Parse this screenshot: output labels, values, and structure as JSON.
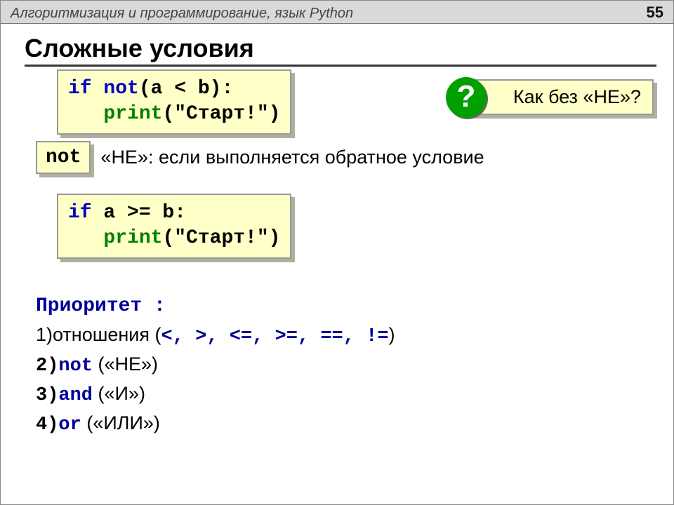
{
  "header": {
    "title": "Алгоритмизация и программирование, язык Python",
    "page": "55"
  },
  "heading": "Сложные условия",
  "code1": {
    "tok_if": "if",
    "tok_not": "not",
    "tok_cond": "(a < b):",
    "tok_print": "print",
    "tok_arg": "(\"Старт!\")",
    "indent": "   "
  },
  "callout": {
    "q": "?",
    "text": "Как без «НЕ»?"
  },
  "not_label": "not",
  "not_desc": "«НЕ»: если выполняется обратное условие",
  "code2": {
    "tok_if": "if",
    "tok_cond": " a >= b:",
    "tok_print": "print",
    "tok_arg": "(\"Старт!\")",
    "indent": "   "
  },
  "priority": {
    "title": "Приоритет :",
    "item1_pre": "1)отношения (",
    "item1_ops": "<, >, <=, >=, ==, !=",
    "item1_post": ")",
    "item2_num": "2)",
    "item2_kw": "not",
    "item2_txt": " («НЕ»)",
    "item3_num": "3)",
    "item3_kw": "and",
    "item3_txt": " («И»)",
    "item4_num": "4)",
    "item4_kw": "or",
    "item4_txt": " («ИЛИ»)"
  }
}
